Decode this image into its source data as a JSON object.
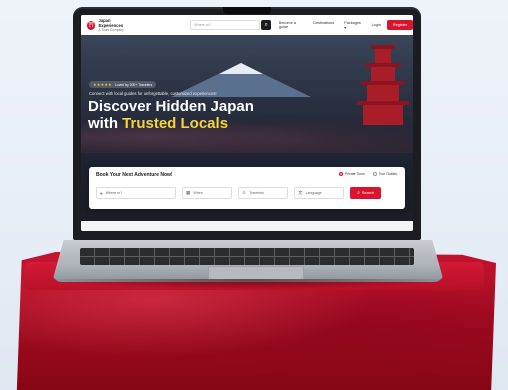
{
  "nav": {
    "brand_line1": "Japan Experiences",
    "brand_line2": "& Tours Company",
    "search_placeholder": "Where to?",
    "links": [
      "Become a guide",
      "Destinations",
      "Packages ▾"
    ],
    "login": "Login",
    "register": "Register"
  },
  "hero": {
    "rating_stars": "★★★★★",
    "rating_text": "Loved by 200+ Travelers",
    "tagline": "Connect with local guides for unforgettable, customized experiences!",
    "headline_line1": "Discover Hidden Japan",
    "headline_with": "with ",
    "headline_accent": "Trusted Locals"
  },
  "booking": {
    "title": "Book Your Next Adventure Now!",
    "option_private": "Private Tours",
    "option_tour_guides": "Tour Guides",
    "where_placeholder": "Where to?",
    "when_placeholder": "When",
    "travelers_placeholder": "Travelers",
    "language_placeholder": "Language",
    "search_label": "Search"
  },
  "colors": {
    "brand_red": "#d8142f",
    "accent_yellow": "#f2d43b",
    "hero_dark": "#2a2f3e"
  },
  "icons": {
    "location": "pin-icon",
    "calendar": "calendar-icon",
    "travelers": "person-icon",
    "language": "translate-icon",
    "search": "magnifier-icon"
  }
}
